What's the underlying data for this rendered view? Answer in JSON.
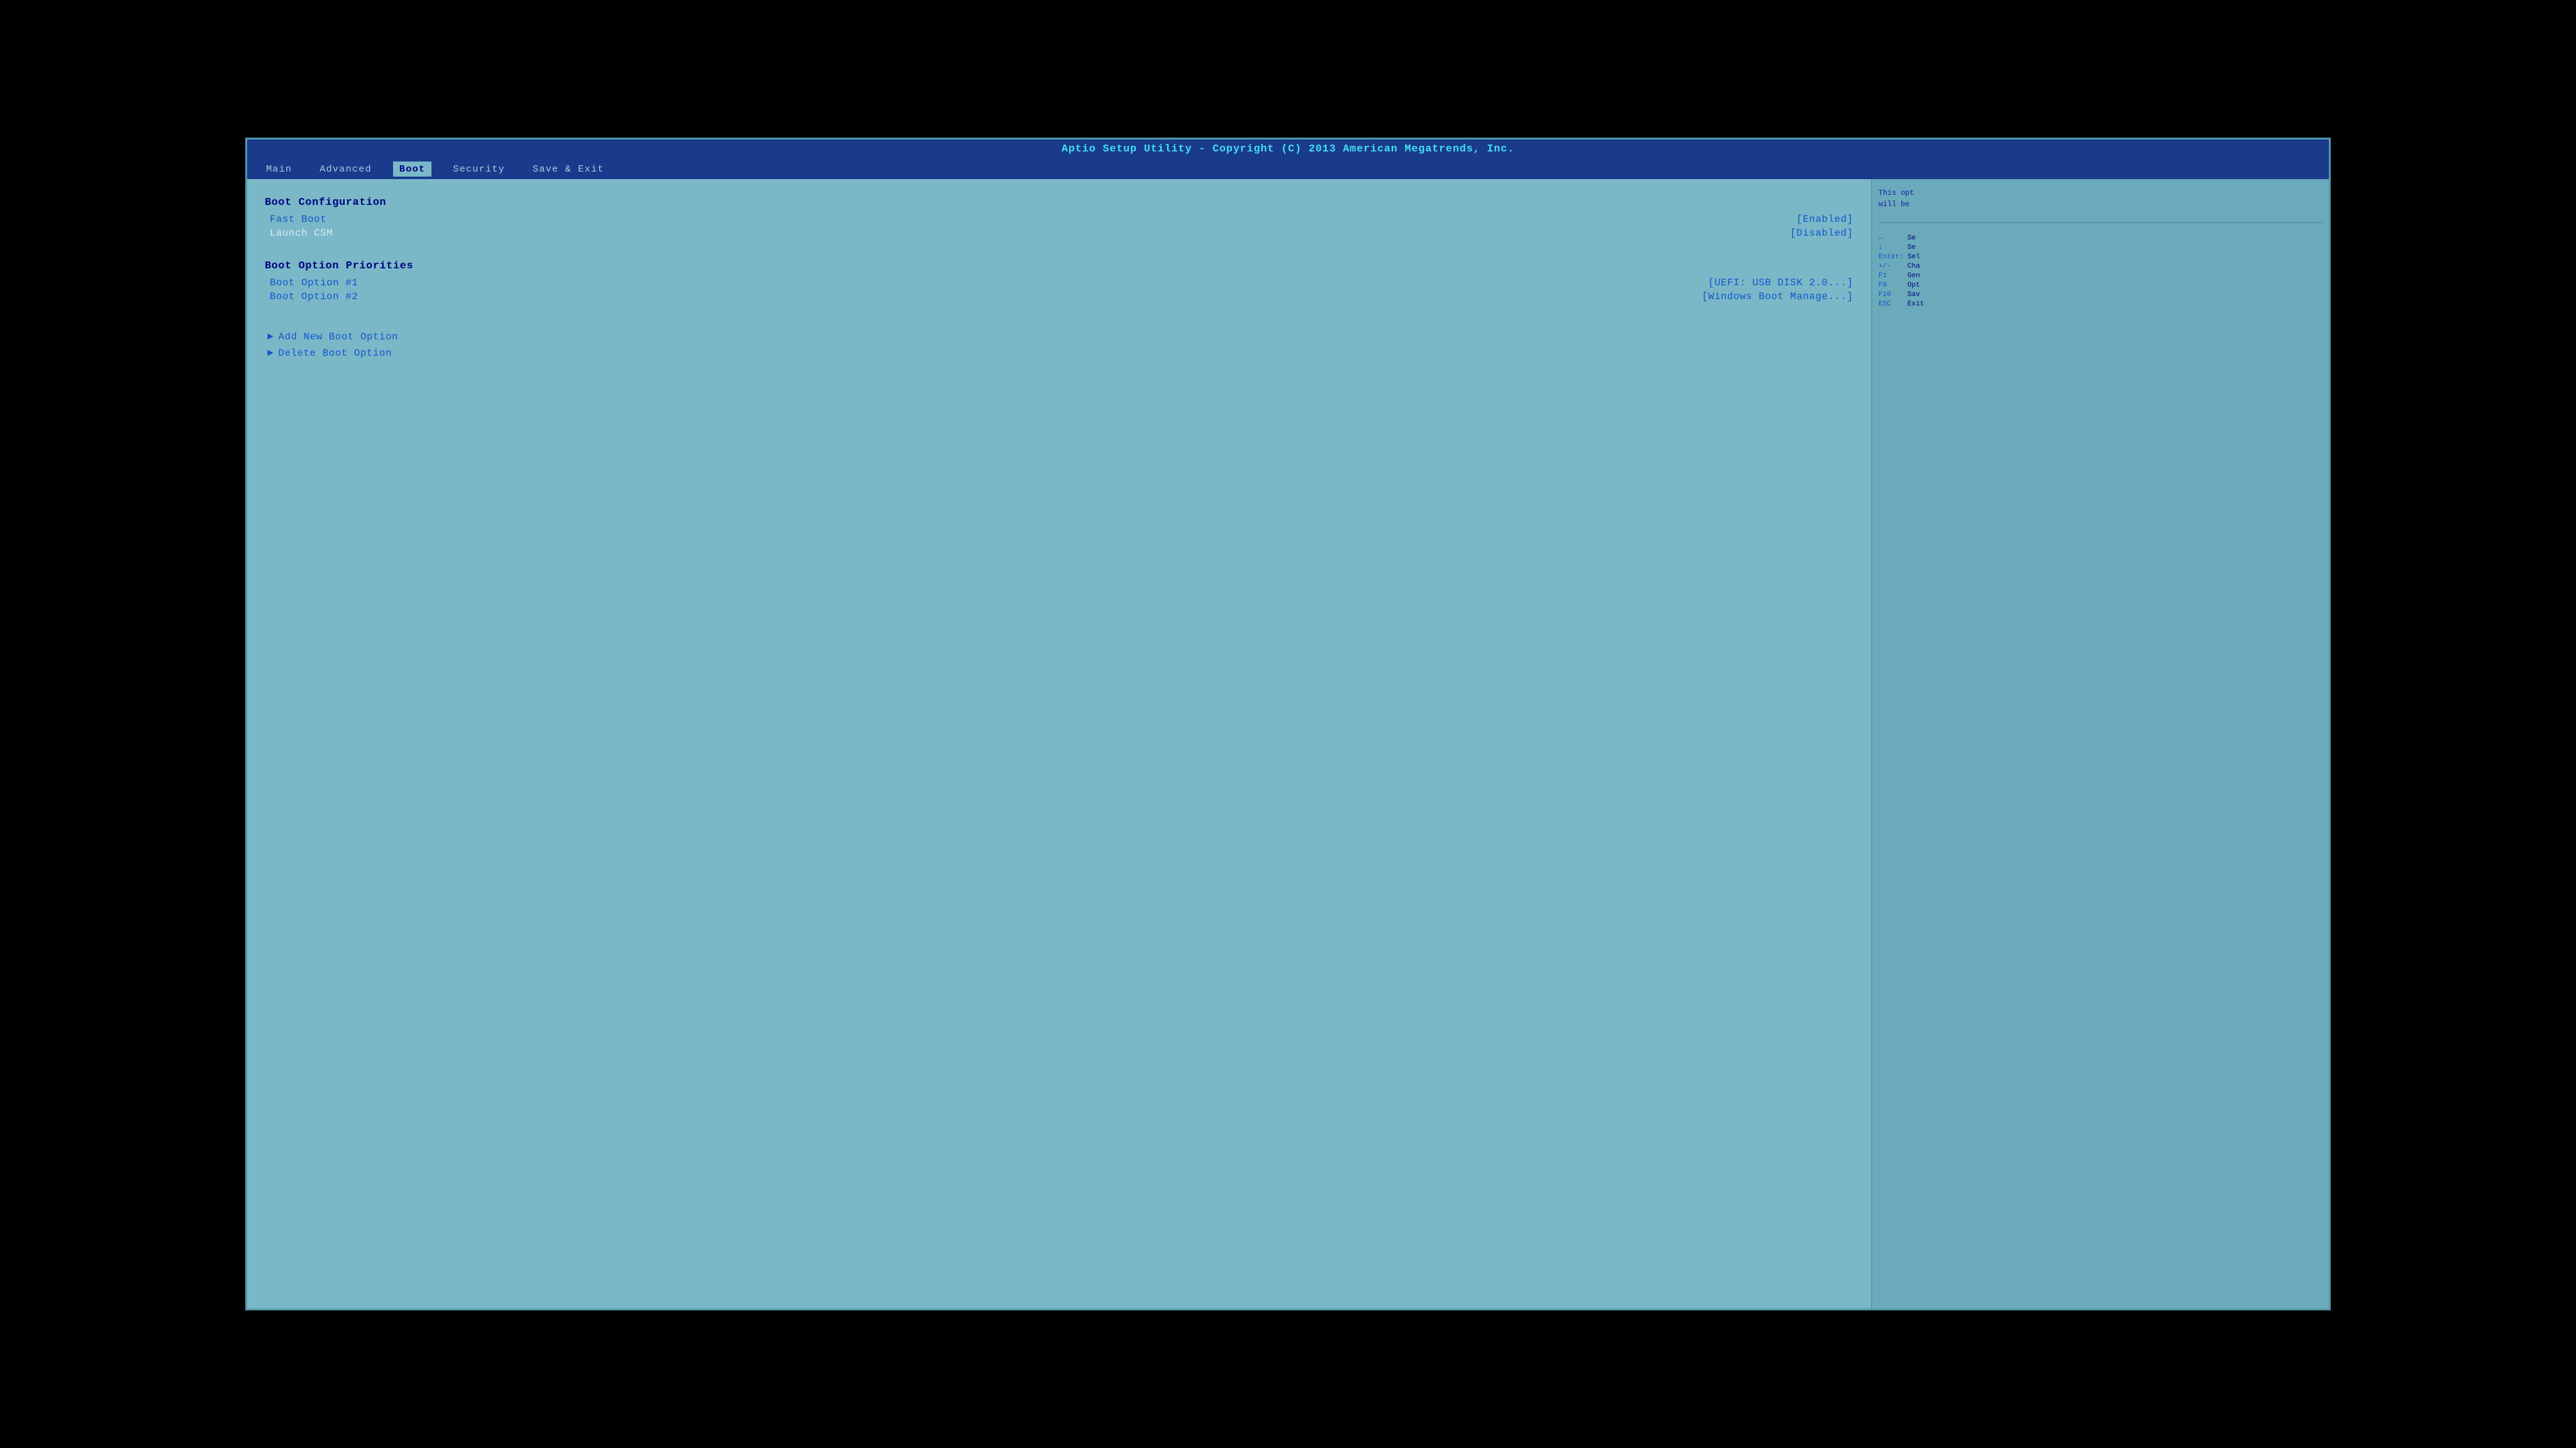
{
  "title_bar": {
    "text": "Aptio Setup Utility - Copyright (C) 2013 American Megatrends, Inc."
  },
  "nav": {
    "tabs": [
      {
        "label": "Main",
        "active": false
      },
      {
        "label": "Advanced",
        "active": false
      },
      {
        "label": "Boot",
        "active": true
      },
      {
        "label": "Security",
        "active": false
      },
      {
        "label": "Save & Exit",
        "active": false
      }
    ]
  },
  "main": {
    "sections": [
      {
        "heading": "Boot Configuration",
        "settings": [
          {
            "label": "Fast Boot",
            "value": "[Enabled]",
            "style": "blue"
          },
          {
            "label": "Launch CSM",
            "value": "[Disabled]",
            "style": "white"
          }
        ]
      },
      {
        "heading": "Boot Option Priorities",
        "settings": [
          {
            "label": "Boot Option #1",
            "value": "[UEFI:  USB DISK 2.0...]",
            "style": "blue"
          },
          {
            "label": "Boot Option #2",
            "value": "[Windows Boot Manage...]",
            "style": "blue"
          }
        ]
      }
    ],
    "submenu_items": [
      {
        "label": "Add New Boot Option"
      },
      {
        "label": "Delete Boot Option"
      }
    ]
  },
  "right_panel": {
    "help_text": "This opt",
    "help_text2": "will be",
    "keys": [
      {
        "key": "↔",
        "desc": "Se"
      },
      {
        "key": "↕",
        "desc": "Se"
      },
      {
        "key": "Enter:",
        "desc": "Sel"
      },
      {
        "key": "+/-",
        "desc": "Cha"
      },
      {
        "key": "F1",
        "desc": "Gen"
      },
      {
        "key": "F9",
        "desc": "Opt"
      },
      {
        "key": "F10",
        "desc": "Sav"
      },
      {
        "key": "ESC",
        "desc": "Exit"
      }
    ]
  }
}
